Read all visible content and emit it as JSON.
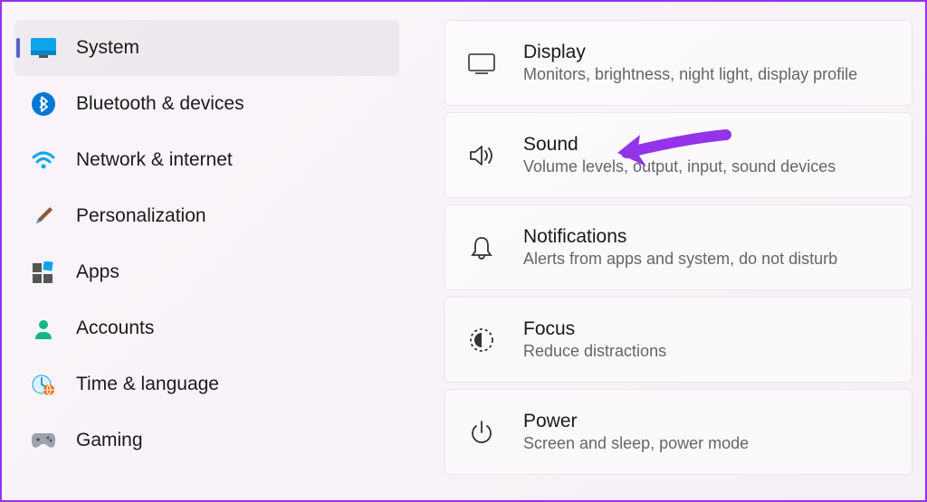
{
  "sidebar": {
    "items": [
      {
        "label": "System"
      },
      {
        "label": "Bluetooth & devices"
      },
      {
        "label": "Network & internet"
      },
      {
        "label": "Personalization"
      },
      {
        "label": "Apps"
      },
      {
        "label": "Accounts"
      },
      {
        "label": "Time & language"
      },
      {
        "label": "Gaming"
      }
    ]
  },
  "cards": [
    {
      "title": "Display",
      "desc": "Monitors, brightness, night light, display profile"
    },
    {
      "title": "Sound",
      "desc": "Volume levels, output, input, sound devices"
    },
    {
      "title": "Notifications",
      "desc": "Alerts from apps and system, do not disturb"
    },
    {
      "title": "Focus",
      "desc": "Reduce distractions"
    },
    {
      "title": "Power",
      "desc": "Screen and sleep, power mode"
    }
  ],
  "colors": {
    "accent": "#5b5fc7",
    "annotation": "#9333ea"
  }
}
